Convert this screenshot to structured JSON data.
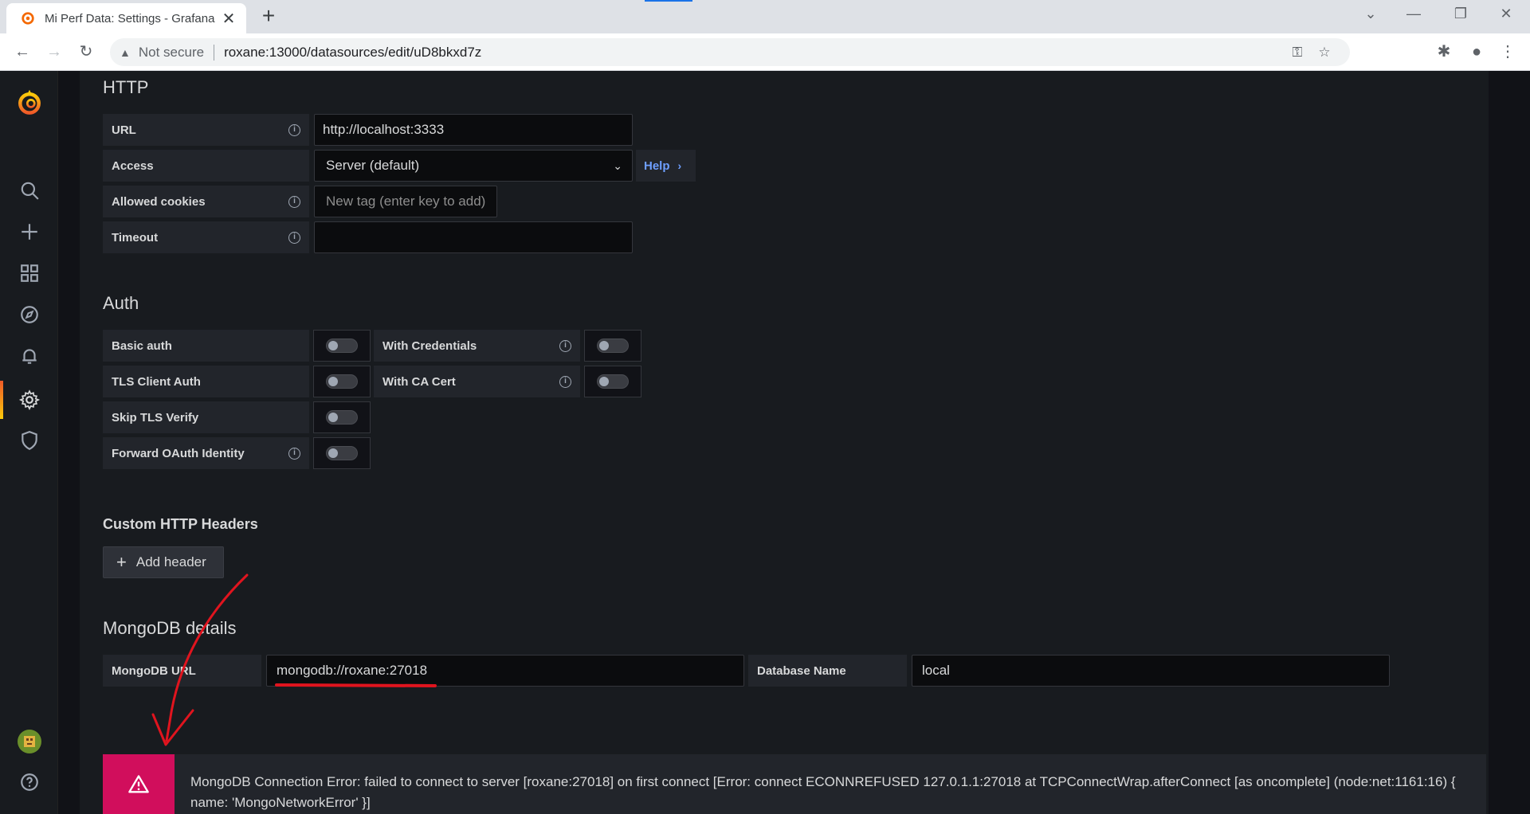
{
  "browser": {
    "tab_title": "Mi Perf Data: Settings - Grafana",
    "security_label": "Not secure",
    "url": "roxane:13000/datasources/edit/uD8bkxd7z"
  },
  "http": {
    "heading": "HTTP",
    "url_label": "URL",
    "url_value": "http://localhost:3333",
    "access_label": "Access",
    "access_value": "Server (default)",
    "help_label": "Help",
    "cookies_label": "Allowed cookies",
    "cookies_placeholder": "New tag (enter key to add)",
    "timeout_label": "Timeout",
    "timeout_value": ""
  },
  "auth": {
    "heading": "Auth",
    "basic_auth": "Basic auth",
    "with_credentials": "With Credentials",
    "tls_client_auth": "TLS Client Auth",
    "with_ca_cert": "With CA Cert",
    "skip_tls_verify": "Skip TLS Verify",
    "forward_oauth": "Forward OAuth Identity"
  },
  "custom_headers": {
    "heading": "Custom HTTP Headers",
    "add_label": "Add header"
  },
  "mongodb": {
    "heading": "MongoDB details",
    "url_label": "MongoDB URL",
    "url_value": "mongodb://roxane:27018",
    "db_label": "Database Name",
    "db_value": "local"
  },
  "alert": {
    "message": "MongoDB Connection Error: failed to connect to server [roxane:27018] on first connect [Error: connect ECONNREFUSED 127.0.1.1:27018 at TCPConnectWrap.afterConnect [as oncomplete] (node:net:1161:16) { name: 'MongoNetworkError' }]"
  },
  "colors": {
    "accent_error": "#d10e5c",
    "annotation_red": "#e0141e",
    "link_blue": "#6e9fff"
  }
}
